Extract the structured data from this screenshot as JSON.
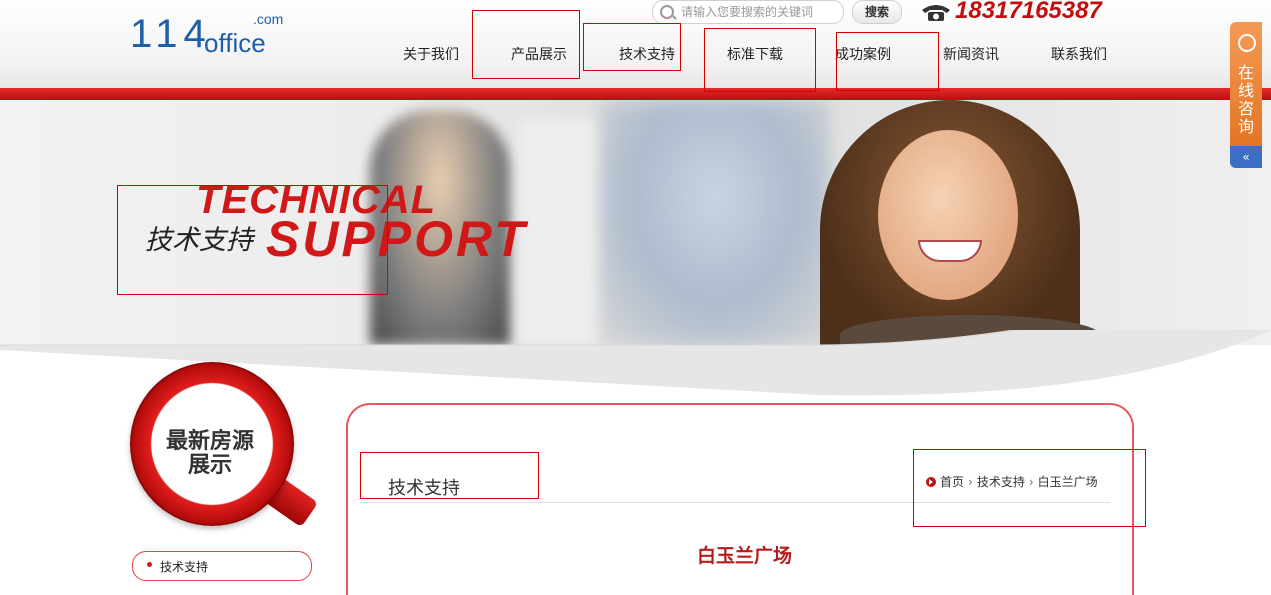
{
  "header": {
    "logo": {
      "number": "114",
      "name": "office",
      "tld": ".com"
    },
    "search": {
      "placeholder": "请输入您要搜索的关键词",
      "button": "搜索"
    },
    "phone": "18317165387"
  },
  "nav": {
    "items": [
      "关于我们",
      "产品展示",
      "技术支持",
      "标准下载",
      "成功案例",
      "新闻资讯",
      "联系我们"
    ]
  },
  "banner": {
    "title_en_line1": "TECHNICAL",
    "title_en_line2": "SUPPORT",
    "title_cn": "技术支持"
  },
  "sidebar": {
    "badge_line1": "最新房源",
    "badge_line2": "展示",
    "items": [
      "技术支持"
    ]
  },
  "content": {
    "section_title": "技术支持",
    "breadcrumb": [
      "首页",
      "技术支持",
      "白玉兰广场"
    ],
    "article_title": "白玉兰广场"
  },
  "consult": {
    "label": "在线咨询",
    "collapse": "«"
  },
  "colors": {
    "brand_red": "#d11818",
    "logo_blue": "#1f5fa8",
    "consult_orange": "#e8842d"
  }
}
